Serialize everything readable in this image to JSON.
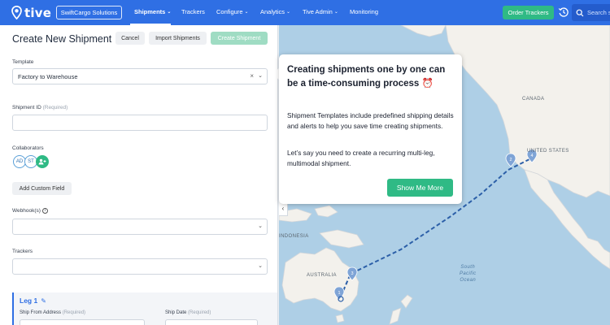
{
  "nav": {
    "logo_text": "tive",
    "org_button": "SwiftCargo Solutions",
    "items": [
      {
        "label": "Shipments",
        "active": true,
        "has_menu": true
      },
      {
        "label": "Trackers",
        "active": false,
        "has_menu": false
      },
      {
        "label": "Configure",
        "active": false,
        "has_menu": true
      },
      {
        "label": "Analytics",
        "active": false,
        "has_menu": true
      },
      {
        "label": "Tive Admin",
        "active": false,
        "has_menu": true
      },
      {
        "label": "Monitoring",
        "active": false,
        "has_menu": false
      }
    ],
    "order_button": "Order Trackers",
    "history_icon": "history-icon",
    "search_placeholder": "Search sh",
    "color_primary": "#2f6fe4",
    "color_accent": "#2fba85"
  },
  "form": {
    "title": "Create New Shipment",
    "cancel": "Cancel",
    "import": "Import Shipments",
    "create": "Create Shipment",
    "template_label": "Template",
    "template_value": "Factory to Warehouse",
    "shipment_id_label": "Shipment ID",
    "required": "(Required)",
    "collaborators_label": "Collaborators",
    "collaborators": [
      "AD",
      "ST"
    ],
    "add_custom_field": "Add Custom Field",
    "webhooks_label": "Webhook(s)",
    "trackers_label": "Trackers",
    "leg_title": "Leg 1",
    "ship_from_label": "Ship From Address",
    "ship_date_label": "Ship Date"
  },
  "map": {
    "labels": [
      "CANADA",
      "UNITED STATES",
      "INDONESIA",
      "AUSTRALIA"
    ],
    "ocean_label": [
      "South",
      "Pacific",
      "Ocean"
    ],
    "markers": [
      "2",
      "4",
      "3",
      "1"
    ]
  },
  "tooltip": {
    "heading": "Creating shipments one by one can be a time-consuming process",
    "heading_emoji": "⏰",
    "paragraph1": "Shipment Templates include predefined shipping details and alerts to help you save time creating shipments.",
    "paragraph2": "Let’s say you need to create a recurring multi-leg, multimodal shipment.",
    "button": "Show Me More"
  }
}
